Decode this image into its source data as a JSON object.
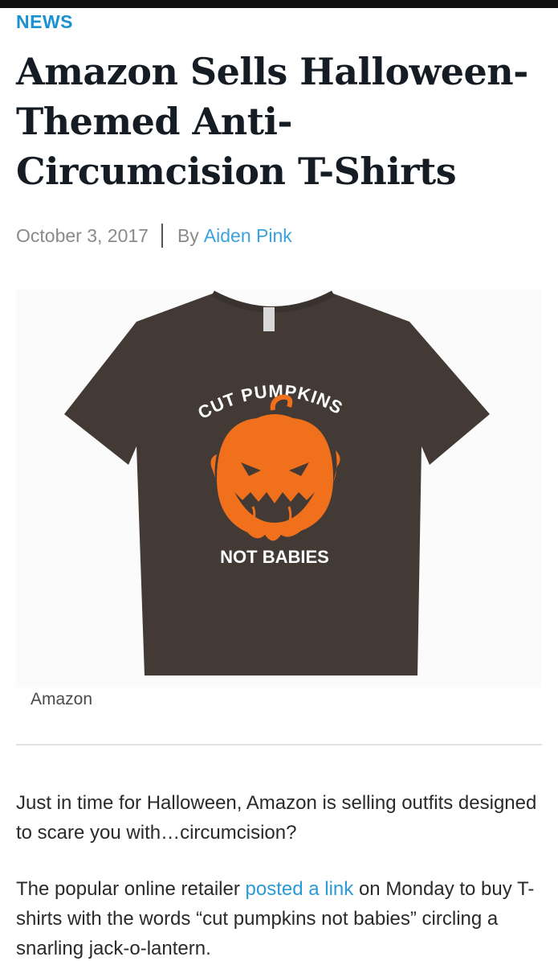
{
  "article": {
    "kicker": "NEWS",
    "headline": "Amazon Sells Halloween-Themed Anti-Circumcision T-Shirts",
    "date": "October 3, 2017",
    "by_prefix": "By",
    "author": "Aiden Pink"
  },
  "figure": {
    "shirt_text_top": "CUT PUMPKINS",
    "shirt_text_bottom": "NOT BABIES",
    "caption": "Amazon",
    "colors": {
      "shirt": "#433a36",
      "pumpkin": "#f0701c",
      "print": "#ffffff"
    }
  },
  "body": {
    "p1": "Just in time for Halloween, Amazon is selling outfits designed to scare you with…circumcision?",
    "p2_before": "The popular online retailer ",
    "p2_link": "posted a link",
    "p2_after": " on Monday to buy T-shirts with the words “cut pumpkins not babies” circling a snarling jack-o-lantern."
  }
}
